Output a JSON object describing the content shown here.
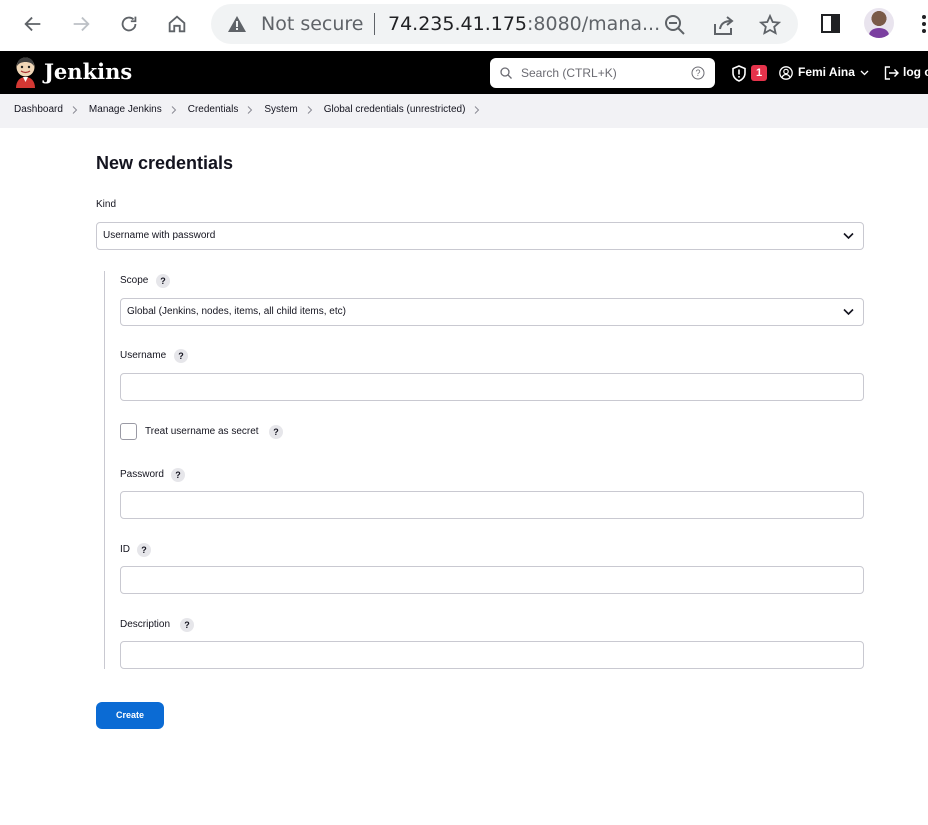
{
  "browser": {
    "security_label": "Not secure",
    "url_host": "74.235.41.175",
    "url_rest": ":8080/mana..."
  },
  "header": {
    "brand": "Jenkins",
    "search_placeholder": "Search (CTRL+K)",
    "alert_count": "1",
    "user_name": "Femi Aina",
    "logout_label": "log out",
    "colors": {
      "header_bg": "#000000",
      "badge": "#e5334b"
    }
  },
  "breadcrumb": [
    "Dashboard",
    "Manage Jenkins",
    "Credentials",
    "System",
    "Global credentials (unrestricted)"
  ],
  "form": {
    "title": "New credentials",
    "kind_label": "Kind",
    "kind_value": "Username with password",
    "scope_label": "Scope",
    "scope_value": "Global (Jenkins, nodes, items, all child items, etc)",
    "username_label": "Username",
    "username_value": "",
    "treat_secret_label": "Treat username as secret",
    "treat_secret_checked": false,
    "password_label": "Password",
    "password_value": "",
    "id_label": "ID",
    "id_value": "",
    "description_label": "Description",
    "description_value": "",
    "help_glyph": "?",
    "create_label": "Create",
    "colors": {
      "primary_button": "#0b6bd4"
    }
  }
}
